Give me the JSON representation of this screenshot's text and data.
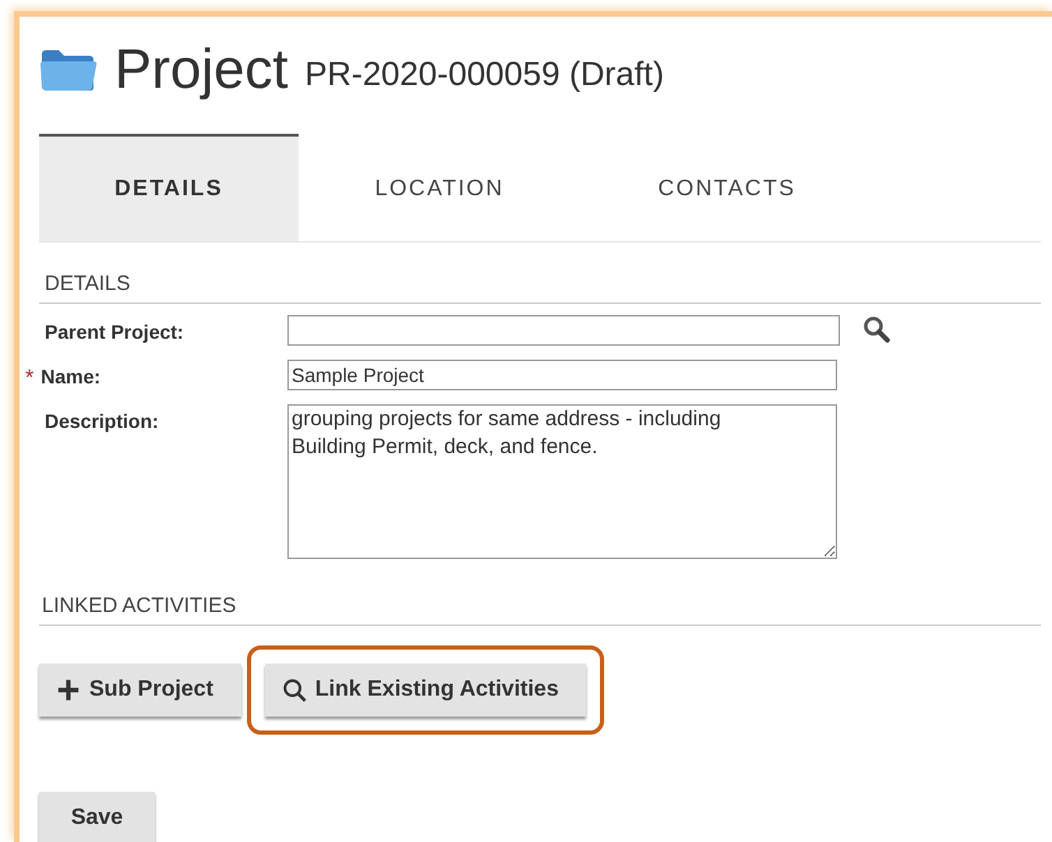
{
  "header": {
    "title": "Project",
    "subtitle": "PR-2020-000059 (Draft)"
  },
  "tabs": [
    {
      "label": "DETAILS",
      "selected": true
    },
    {
      "label": "LOCATION",
      "selected": false
    },
    {
      "label": "CONTACTS",
      "selected": false
    }
  ],
  "details_section": {
    "heading": "DETAILS",
    "fields": [
      {
        "kind": "lookup",
        "label": "Parent Project:"
      },
      {
        "kind": "text",
        "label": "Name:",
        "required_mark": "*",
        "value": "Sample Project"
      },
      {
        "kind": "textarea",
        "label": "Description:",
        "value": "grouping projects for same address - including Building Permit, deck, and fence."
      }
    ]
  },
  "linked_section": {
    "heading": "LINKED ACTIVITIES",
    "buttons": [
      {
        "kind": "add",
        "label": "Sub Project",
        "highlighted": false
      },
      {
        "kind": "search",
        "label": "Link Existing Activities",
        "highlighted": true
      }
    ]
  },
  "save_button": {
    "label": "Save"
  }
}
